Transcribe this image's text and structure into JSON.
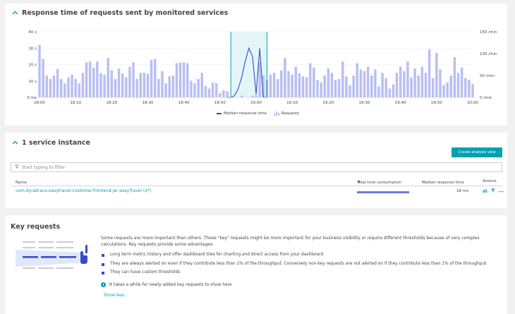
{
  "response_panel": {
    "title": "Response time of requests sent by monitored services",
    "legend": {
      "median": "Median response time",
      "requests": "Requests"
    }
  },
  "chart_data": {
    "type": "bar",
    "title": "Response time of requests sent by monitored services",
    "x": [
      "18:00",
      "18:01",
      "18:02",
      "18:03",
      "18:04",
      "18:05",
      "18:06",
      "18:07",
      "18:08",
      "18:09",
      "18:10",
      "18:11",
      "18:12",
      "18:13",
      "18:14",
      "18:15",
      "18:16",
      "18:17",
      "18:18",
      "18:19",
      "18:20",
      "18:21",
      "18:22",
      "18:23",
      "18:24",
      "18:25",
      "18:26",
      "18:27",
      "18:28",
      "18:29",
      "18:30",
      "18:31",
      "18:32",
      "18:33",
      "18:34",
      "18:35",
      "18:36",
      "18:37",
      "18:38",
      "18:39",
      "18:40",
      "18:41",
      "18:42",
      "18:43",
      "18:44",
      "18:45",
      "18:46",
      "18:47",
      "18:48",
      "18:49",
      "18:50",
      "18:51",
      "18:52",
      "18:53",
      "18:54",
      "18:55",
      "18:56",
      "18:57",
      "18:58",
      "18:59",
      "19:00",
      "19:01",
      "19:02",
      "19:03",
      "19:04",
      "19:05",
      "19:06",
      "19:07",
      "19:08",
      "19:09",
      "19:10",
      "19:11",
      "19:12",
      "19:13",
      "19:14",
      "19:15",
      "19:16",
      "19:17",
      "19:18",
      "19:19",
      "19:20",
      "19:21",
      "19:22",
      "19:23",
      "19:24",
      "19:25",
      "19:26",
      "19:27",
      "19:28",
      "19:29",
      "19:30",
      "19:31",
      "19:32",
      "19:33",
      "19:34",
      "19:35",
      "19:36",
      "19:37",
      "19:38",
      "19:39",
      "19:40",
      "19:41",
      "19:42",
      "19:43",
      "19:44",
      "19:45",
      "19:46",
      "19:47",
      "19:48",
      "19:49",
      "19:50",
      "19:51",
      "19:52",
      "19:53",
      "19:54",
      "19:55",
      "19:56",
      "19:57",
      "19:58",
      "19:59",
      "20:00"
    ],
    "x_ticks": [
      "18:00",
      "18:10",
      "18:20",
      "18:30",
      "18:40",
      "18:50",
      "19:00",
      "19:10",
      "19:20",
      "19:30",
      "19:40",
      "19:50",
      "20:00"
    ],
    "series": [
      {
        "name": "Requests",
        "axis": "right",
        "type": "bar",
        "values": [
          120,
          88,
          50,
          42,
          50,
          65,
          42,
          32,
          46,
          52,
          42,
          32,
          56,
          80,
          82,
          68,
          82,
          55,
          52,
          90,
          62,
          42,
          66,
          55,
          46,
          70,
          80,
          42,
          56,
          56,
          54,
          86,
          88,
          42,
          60,
          32,
          48,
          50,
          78,
          80,
          80,
          78,
          38,
          32,
          42,
          56,
          26,
          20,
          34,
          32,
          10,
          16,
          14,
          0,
          0,
          0,
          4,
          0,
          0,
          4,
          6,
          80,
          50,
          40,
          52,
          56,
          42,
          62,
          90,
          60,
          52,
          70,
          55,
          48,
          46,
          78,
          68,
          40,
          34,
          50,
          66,
          56,
          40,
          42,
          82,
          48,
          28,
          50,
          78,
          64,
          60,
          70,
          50,
          64,
          25,
          56,
          44,
          20,
          30,
          56,
          70,
          60,
          82,
          45,
          66,
          50,
          70,
          56,
          110,
          44,
          102,
          64,
          28,
          34,
          50,
          92,
          56,
          68,
          44,
          40,
          30
        ]
      },
      {
        "name": "Median response time",
        "axis": "left",
        "type": "line",
        "x_range": [
          "18:52",
          "19:03"
        ],
        "values": [
          0,
          0,
          1,
          5,
          12,
          22,
          30,
          25,
          2,
          30,
          0,
          0
        ]
      }
    ],
    "y_left": {
      "ticks": [
        "0 ms",
        "10 s",
        "20 s",
        "30 s",
        "40 s"
      ],
      "range": [
        0,
        40
      ]
    },
    "y_right": {
      "ticks": [
        "0 /min",
        "50 /min",
        "100 /min",
        "150 /min"
      ],
      "range": [
        0,
        150
      ]
    },
    "highlight_range": [
      "18:53",
      "19:03"
    ],
    "legend_position": "bottom-center"
  },
  "instances_panel": {
    "title": "1 service instance",
    "create_button": "Create analysis view",
    "filter_placeholder": "Start typing to filter",
    "columns": {
      "name": "Name",
      "total": "Total time consumption",
      "median": "Median response time",
      "actions": "Actions"
    },
    "rows": [
      {
        "name": "com.dynatrace.easytravel.customer.frontend.jar easyTravel (x*)",
        "total_fraction": 1.0,
        "median": "18 ms"
      }
    ]
  },
  "key_requests": {
    "title": "Key requests",
    "intro": "Some requests are more important than others. These \"key\" requests might be more important for your business visibility or require different thresholds because of very complex calculations. Key requests provide some advantages:",
    "bullets": [
      "Long term metric history and offer dashboard tiles for charting and direct access from your dashboard",
      "They are always alerted on even if they contribute less than 1% of the throughput. Conversely non-key requests are not alerted on if they contribute less than 1% of the throughput",
      "They can have custom thresholds"
    ],
    "info": "It takes a while for newly added key requests to show here",
    "show_less": "Show less..."
  },
  "colors": {
    "accent": "#00a1b2",
    "bar": "#b9bff2",
    "line": "#3a4bc8",
    "text": "#454646"
  },
  "icons": [
    "chevron-up-icon",
    "filter-icon",
    "chart-icon",
    "funnel-icon",
    "more-icon",
    "info-icon",
    "hand-pointer-icon"
  ]
}
